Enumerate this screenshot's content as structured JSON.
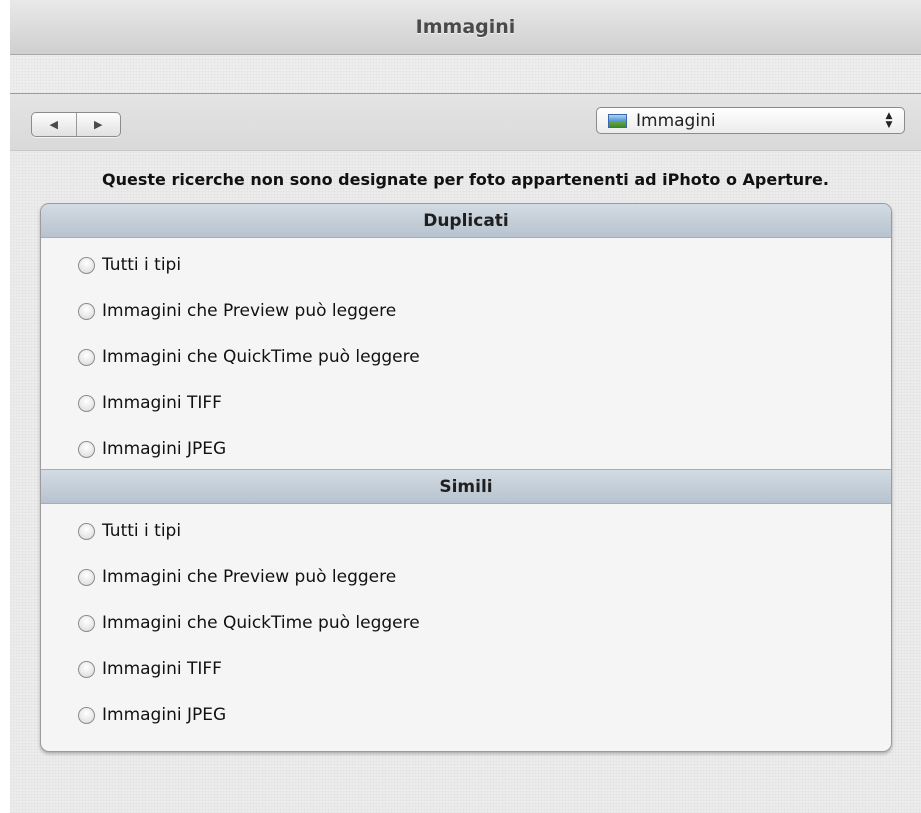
{
  "window": {
    "title": "Immagini"
  },
  "nav": {
    "back_glyph": "◀",
    "forward_glyph": "▶"
  },
  "popup": {
    "selected": "Immagini",
    "icon": "picture-icon",
    "arrow_up": "▲",
    "arrow_down": "▼"
  },
  "notice": "Queste ricerche non sono designate per foto appartenenti ad iPhoto o Aperture.",
  "sections": [
    {
      "header": "Duplicati",
      "options": [
        "Tutti i tipi",
        "Immagini che Preview può leggere",
        "Immagini che QuickTime può leggere",
        "Immagini TIFF",
        "Immagini JPEG"
      ]
    },
    {
      "header": "Simili",
      "options": [
        "Tutti i tipi",
        "Immagini che Preview può leggere",
        "Immagini che QuickTime può leggere",
        "Immagini TIFF",
        "Immagini JPEG"
      ]
    }
  ],
  "colors": {
    "section_header": "#c3cdd8",
    "panel_bg": "#f5f5f5",
    "window_bg": "#ececec"
  }
}
